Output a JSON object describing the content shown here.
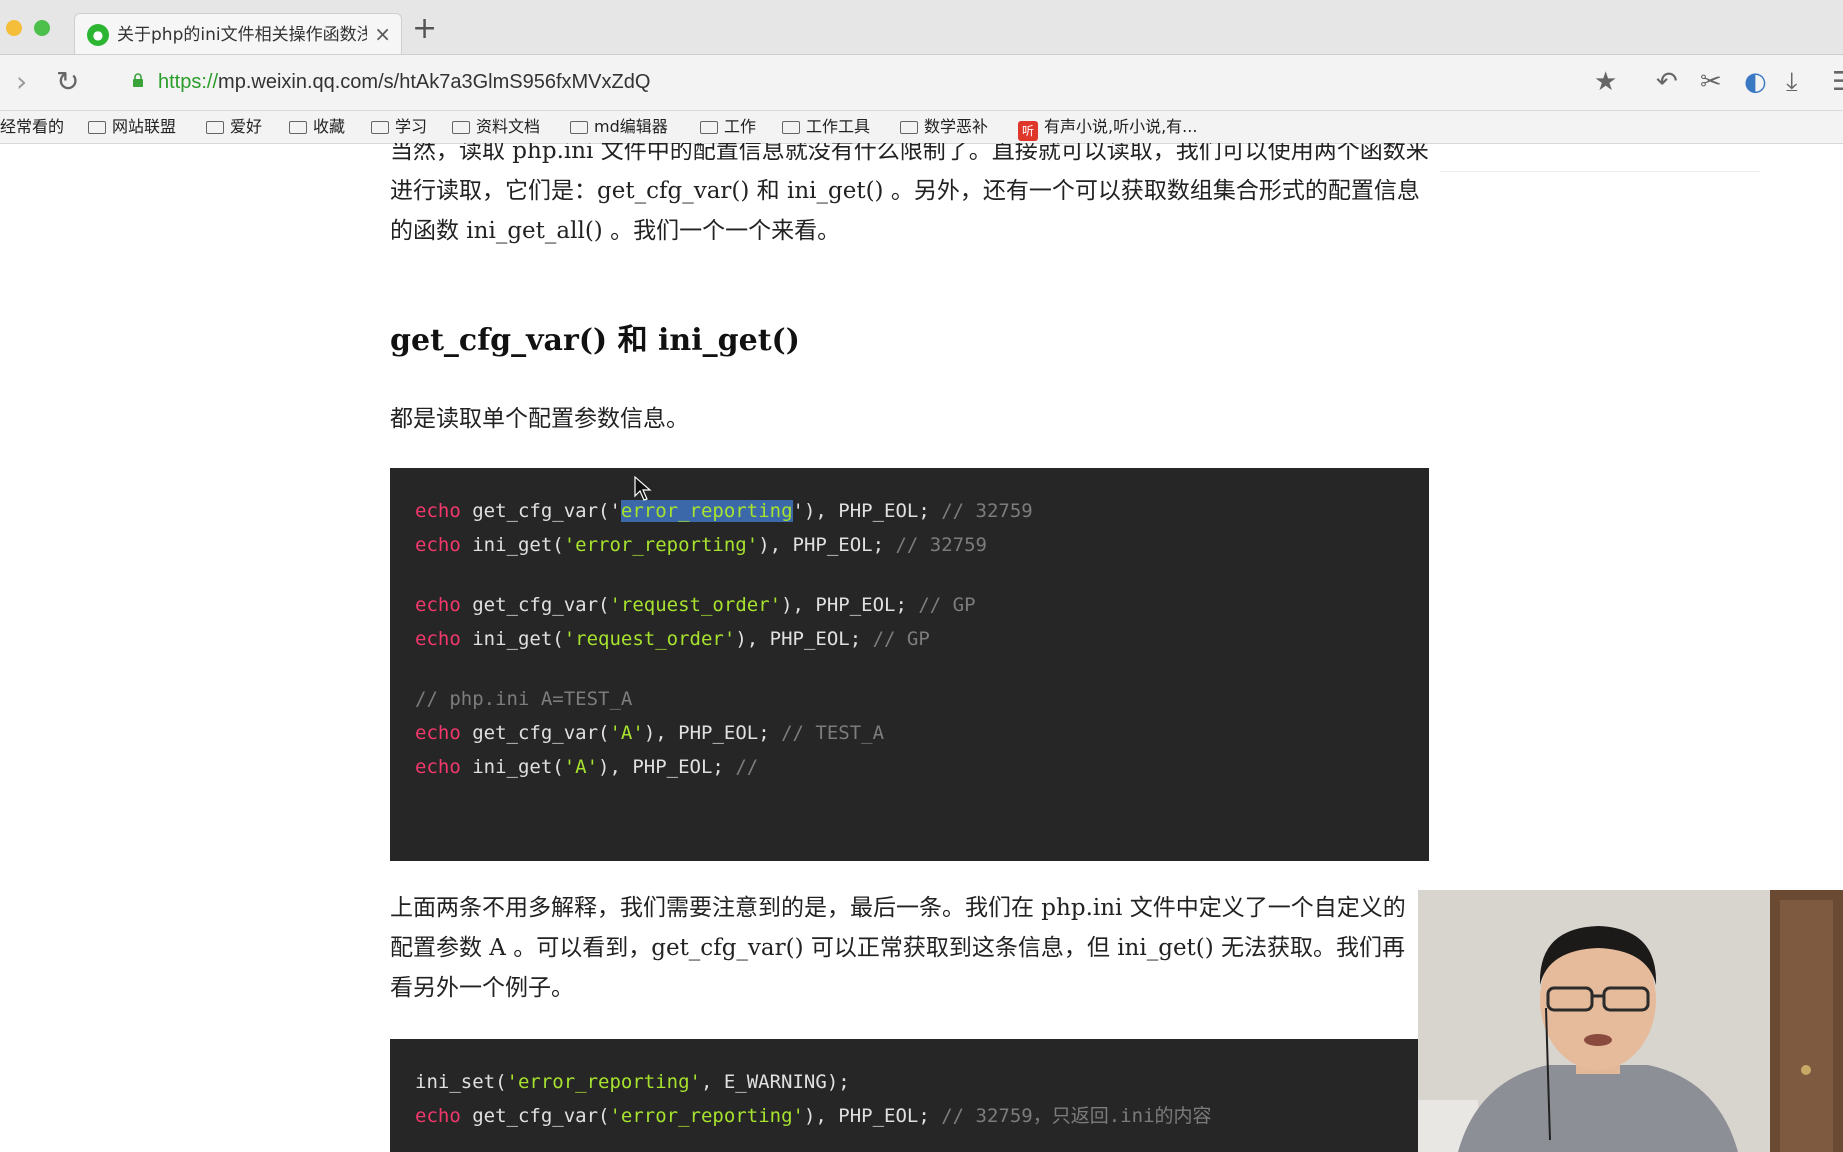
{
  "browser": {
    "tab": {
      "title": "关于php的ini文件相关操作函数浅析",
      "close": "×",
      "favicon": "wechat-icon"
    },
    "new_tab": "+",
    "url": {
      "scheme": "https://",
      "rest": "mp.weixin.qq.com/s/htAk7a3GlmS956fxMVxZdQ"
    },
    "bookmarks": [
      {
        "label": "经常看的",
        "icon": "none"
      },
      {
        "label": "网站联盟",
        "icon": "folder-icon"
      },
      {
        "label": "爱好",
        "icon": "folder-icon"
      },
      {
        "label": "收藏",
        "icon": "folder-icon"
      },
      {
        "label": "学习",
        "icon": "folder-icon"
      },
      {
        "label": "资料文档",
        "icon": "folder-icon"
      },
      {
        "label": "md编辑器",
        "icon": "folder-icon"
      },
      {
        "label": "工作",
        "icon": "folder-icon"
      },
      {
        "label": "工作工具",
        "icon": "folder-icon"
      },
      {
        "label": "数学恶补",
        "icon": "folder-icon"
      },
      {
        "label": "有声小说,听小说,有...",
        "icon": "ting-icon",
        "badge": "听"
      }
    ]
  },
  "article": {
    "intro": "当然，读取 php.ini 文件中的配置信息就没有什么限制了。直接就可以读取，我们可以使用两个函数来进行读取，它们是：get_cfg_var() 和 ini_get() 。另外，还有一个可以获取数组集合形式的配置信息的函数 ini_get_all() 。我们一个一个来看。",
    "heading": "get_cfg_var() 和 ini_get()",
    "desc": "都是读取单个配置参数信息。",
    "code1": [
      {
        "kw": "echo",
        "pre": " get_cfg_var('",
        "sel": "error_reporting",
        "post": "'), PHP_EOL; ",
        "comment": "// 32759"
      },
      {
        "kw": "echo",
        "pre": " ini_get(",
        "str": "'error_reporting'",
        "post": "), PHP_EOL; ",
        "comment": "// 32759"
      },
      {
        "kw": "echo",
        "pre": " get_cfg_var(",
        "str": "'request_order'",
        "post": "), PHP_EOL; ",
        "comment": "// GP"
      },
      {
        "kw": "echo",
        "pre": " ini_get(",
        "str": "'request_order'",
        "post": "), PHP_EOL; ",
        "comment": "// GP"
      },
      {
        "comment": "// php.ini A=TEST_A"
      },
      {
        "kw": "echo",
        "pre": " get_cfg_var(",
        "str": "'A'",
        "post": "), PHP_EOL; ",
        "comment": "// TEST_A"
      },
      {
        "kw": "echo",
        "pre": " ini_get(",
        "str": "'A'",
        "post": "), PHP_EOL; ",
        "comment": "//"
      }
    ],
    "explain": "上面两条不用多解释，我们需要注意到的是，最后一条。我们在 php.ini 文件中定义了一个自定义的配置参数 A 。可以看到，get_cfg_var() 可以正常获取到这条信息，但 ini_get() 无法获取。我们再看另外一个例子。",
    "code2": [
      {
        "pre": "ini_set(",
        "str": "'error_reporting'",
        "post": ", E_WARNING);"
      },
      {
        "kw": "echo",
        "pre": " get_cfg_var(",
        "str": "'error_reporting'",
        "post": "), PHP_EOL; ",
        "comment": "// 32759，只返回.ini的内容"
      }
    ]
  }
}
